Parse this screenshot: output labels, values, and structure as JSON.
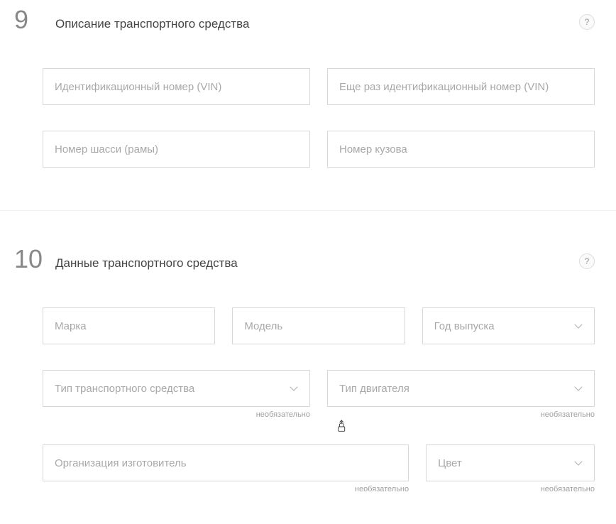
{
  "section9": {
    "number": "9",
    "title": "Описание транспортного средства",
    "help": "?",
    "fields": {
      "vin": {
        "placeholder": "Идентификационный номер (VIN)"
      },
      "vin_confirm": {
        "placeholder": "Еще раз идентификационный номер (VIN)"
      },
      "chassis": {
        "placeholder": "Номер шасси (рамы)"
      },
      "body": {
        "placeholder": "Номер кузова"
      }
    }
  },
  "section10": {
    "number": "10",
    "title": "Данные транспортного средства",
    "help": "?",
    "fields": {
      "brand": {
        "placeholder": "Марка"
      },
      "model": {
        "placeholder": "Модель"
      },
      "year": {
        "placeholder": "Год выпуска"
      },
      "vehicle_type": {
        "placeholder": "Тип транспортного средства",
        "optional": "необязательно"
      },
      "engine_type": {
        "placeholder": "Тип двигателя",
        "optional": "необязательно"
      },
      "manufacturer": {
        "placeholder": "Организация изготовитель",
        "optional": "необязательно"
      },
      "color": {
        "placeholder": "Цвет",
        "optional": "необязательно"
      }
    }
  }
}
